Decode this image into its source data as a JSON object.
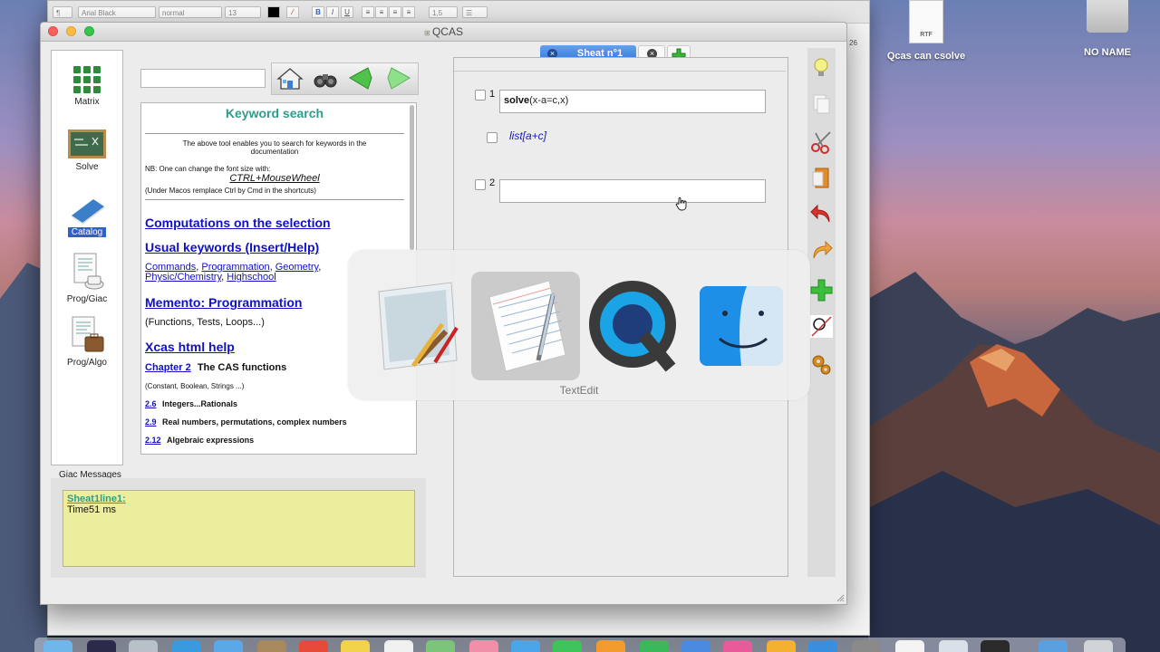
{
  "window": {
    "title": "QCAS"
  },
  "desktop": {
    "file_label": "Qcas can csolve",
    "file_type": "RTF",
    "drive_label": "NO NAME"
  },
  "back_window": {
    "font_name": "Arial Black",
    "font_style": "normal",
    "font_size": "13",
    "line_spacing": "1,5",
    "ruler_mark": "26",
    "bold": "B",
    "italic": "I",
    "underline": "U"
  },
  "sidebar": {
    "items": [
      {
        "label": "Matrix",
        "icon": "matrix-grid-icon"
      },
      {
        "label": "Solve",
        "icon": "chalkboard-icon"
      },
      {
        "label": "Catalog",
        "icon": "book-icon"
      },
      {
        "label": "Prog/Giac",
        "icon": "document-cup-icon"
      },
      {
        "label": "Prog/Algo",
        "icon": "document-briefcase-icon"
      }
    ]
  },
  "search": {
    "value": "",
    "placeholder": ""
  },
  "nav": {
    "icons": [
      "home-icon",
      "binoculars-icon",
      "back-arrow-icon",
      "forward-arrow-icon"
    ]
  },
  "help": {
    "title": "Keyword search",
    "intro_line1": "The above tool enables you to search for keywords in the",
    "intro_line2": "documentation",
    "nb_line": "NB: One can change the font size with:",
    "shortcut": "CTRL+MouseWheel",
    "macos_note": "(Under Macos remplace Ctrl by Cmd in the shortcuts)",
    "link_selection": "Computations on the selection",
    "link_usual": "Usual keywords (Insert/Help)",
    "sublinks": [
      "Commands",
      "Programmation",
      "Geometry",
      "Physic/Chemistry",
      "Highschool"
    ],
    "link_memento": "Memento: Programmation",
    "memento_desc": "(Functions, Tests, Loops...)",
    "link_xcas": "Xcas html help",
    "chapter_link": "Chapter 2",
    "chapter_title": "The CAS functions",
    "chapter_desc": "(Constant, Boolean, Strings ...)",
    "sections": [
      {
        "num": "2.6",
        "title": "Integers...Rationals"
      },
      {
        "num": "2.9",
        "title": "Real numbers, permutations, complex numbers"
      },
      {
        "num": "2.12",
        "title": "Algebraic expressions"
      }
    ]
  },
  "messages": {
    "label": "Giac Messages",
    "line_ref": "Sheat1line1:",
    "timing": "Time51 ms"
  },
  "sheet": {
    "tab_label": "Sheat n°1",
    "rows": [
      {
        "num": "1",
        "cmd": "solve",
        "args": "(x-a=c,x)",
        "result": "list[a+c]"
      },
      {
        "num": "2",
        "value": ""
      }
    ]
  },
  "tools": [
    "lightbulb-icon",
    "copy-icon",
    "scissors-icon",
    "paste-icon",
    "undo-icon",
    "redo-icon",
    "add-icon",
    "plot-icon",
    "settings-gears-icon"
  ],
  "app_switcher": {
    "apps": [
      "Preview",
      "TextEdit",
      "QuickTime Player",
      "Finder"
    ],
    "selected_label": "TextEdit"
  },
  "colors": {
    "accent_blue": "#2f62c8",
    "link_blue": "#1010c8",
    "title_teal": "#2e9d8a",
    "message_bg": "#eded9e"
  }
}
